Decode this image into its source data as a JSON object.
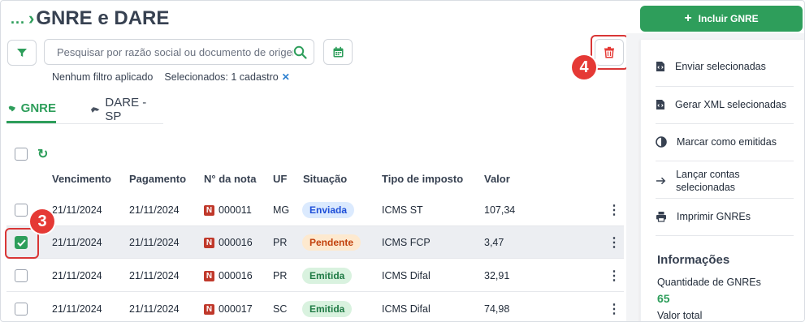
{
  "header": {
    "breadcrumb": "...",
    "title": "GNRE e DARE"
  },
  "search": {
    "placeholder": "Pesquisar por razão social ou documento de origem",
    "value": ""
  },
  "filters": {
    "status": "Nenhum filtro aplicado",
    "selected": "Selecionados: 1 cadastro",
    "clear": "✕"
  },
  "tabs": [
    {
      "label": "GNRE",
      "active": true
    },
    {
      "label": "DARE - SP",
      "active": false
    }
  ],
  "table": {
    "columns": [
      "Vencimento",
      "Pagamento",
      "N° da nota",
      "UF",
      "Situação",
      "Tipo de imposto",
      "Valor"
    ],
    "rows": [
      {
        "vencimento": "21/11/2024",
        "pagamento": "21/11/2024",
        "nota": "000011",
        "uf": "MG",
        "situacao": "Enviada",
        "tipo": "ICMS ST",
        "valor": "107,34",
        "checked": false
      },
      {
        "vencimento": "21/11/2024",
        "pagamento": "21/11/2024",
        "nota": "000016",
        "uf": "PR",
        "situacao": "Pendente",
        "tipo": "ICMS FCP",
        "valor": "3,47",
        "checked": true
      },
      {
        "vencimento": "21/11/2024",
        "pagamento": "21/11/2024",
        "nota": "000016",
        "uf": "PR",
        "situacao": "Emitida",
        "tipo": "ICMS Difal",
        "valor": "32,91",
        "checked": false
      },
      {
        "vencimento": "21/11/2024",
        "pagamento": "21/11/2024",
        "nota": "000017",
        "uf": "SC",
        "situacao": "Emitida",
        "tipo": "ICMS Difal",
        "valor": "74,98",
        "checked": false
      }
    ]
  },
  "badges": {
    "step3": "3",
    "step4": "4"
  },
  "actions": {
    "primary": "Incluir GNRE",
    "menu": [
      {
        "label": "Enviar selecionadas",
        "icon": "file-code-icon"
      },
      {
        "label": "Gerar XML selecionadas",
        "icon": "file-code-icon"
      },
      {
        "label": "Marcar como emitidas",
        "icon": "half-circle-icon"
      },
      {
        "label": "Lançar contas selecionadas",
        "icon": "arrow-right-icon"
      },
      {
        "label": "Imprimir GNREs",
        "icon": "printer-icon"
      }
    ]
  },
  "info": {
    "title": "Informações",
    "qty_label": "Quantidade de GNREs",
    "qty_value": "65",
    "total_label": "Valor total"
  },
  "colors": {
    "accent": "#2e9e5b",
    "danger": "#e53935",
    "enviada_bg": "#dbeafe",
    "enviada_fg": "#1d4ed8",
    "pendente_bg": "#fde9cf",
    "pendente_fg": "#c2410c",
    "emitida_bg": "#d9f2df",
    "emitida_fg": "#1e7a44"
  }
}
